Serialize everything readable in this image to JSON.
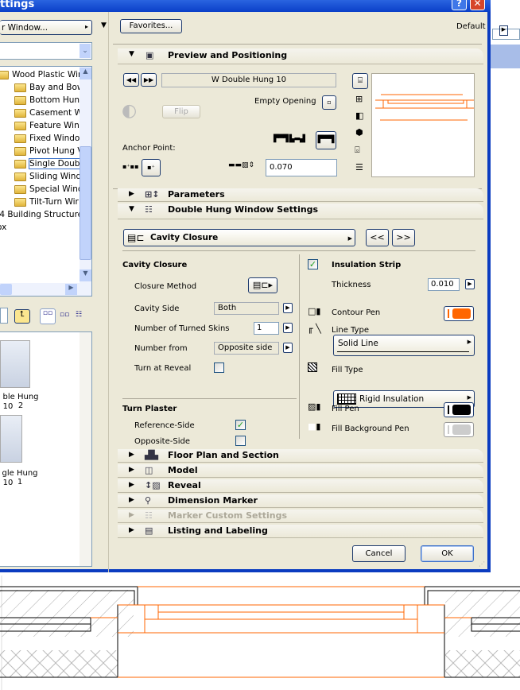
{
  "window": {
    "title": "ttings",
    "help_label": "?",
    "close_label": "✕"
  },
  "left_panel": {
    "dropdown_label": "r Window...",
    "tree": [
      {
        "label": "Wood Plastic Win",
        "level": 0
      },
      {
        "label": "Bay and Bow",
        "level": 1
      },
      {
        "label": "Bottom Hung",
        "level": 1
      },
      {
        "label": "Casement W",
        "level": 1
      },
      {
        "label": "Feature Win",
        "level": 1
      },
      {
        "label": "Fixed Windo",
        "level": 1
      },
      {
        "label": "Pivot Hung V",
        "level": 1
      },
      {
        "label": "Single Double",
        "level": 1,
        "selected": true
      },
      {
        "label": "Sliding Windo",
        "level": 1
      },
      {
        "label": "Special Wind",
        "level": 1
      },
      {
        "label": "Tilt-Turn Wir",
        "level": 1
      },
      {
        "label": ".4 Building Structure",
        "level": -1
      },
      {
        "label": "ox",
        "level": -1
      }
    ],
    "thumbnails": [
      {
        "name": "ble Hung 2",
        "size": "10"
      },
      {
        "name": "gle Hung 1",
        "size": "10"
      }
    ]
  },
  "header": {
    "favorites_label": "Favorites...",
    "default_label": "Default"
  },
  "preview": {
    "title": "Preview and Positioning",
    "object_name": "W Double Hung 10",
    "flip_label": "Flip",
    "empty_opening_label": "Empty Opening",
    "anchor_point_label": "Anchor Point:",
    "offset_value": "0.070"
  },
  "sections": {
    "parameters": "Parameters",
    "double_hung": "Double Hung Window Settings",
    "floor_plan": "Floor Plan and Section",
    "model": "Model",
    "reveal": "Reveal",
    "dimension_marker": "Dimension Marker",
    "marker_custom": "Marker Custom Settings",
    "listing": "Listing and Labeling"
  },
  "settings": {
    "page_select": "Cavity Closure",
    "prev_label": "<<",
    "next_label": ">>",
    "cavity_closure_heading": "Cavity Closure",
    "closure_method_label": "Closure Method",
    "cavity_side_label": "Cavity Side",
    "cavity_side_value": "Both",
    "turned_skins_label": "Number of Turned Skins",
    "turned_skins_value": "1",
    "number_from_label": "Number from",
    "number_from_value": "Opposite side",
    "turn_reveal_label": "Turn at Reveal",
    "turn_reveal_checked": false,
    "turn_plaster_heading": "Turn Plaster",
    "reference_side_label": "Reference-Side",
    "reference_side_checked": true,
    "opposite_side_label": "Opposite-Side",
    "opposite_side_checked": false,
    "insulation_strip_label": "Insulation Strip",
    "insulation_strip_checked": true,
    "thickness_label": "Thickness",
    "thickness_value": "0.010",
    "contour_pen_label": "Contour Pen",
    "contour_pen_color": "#ff6600",
    "line_type_label": "Line Type",
    "line_type_value": "Solid Line",
    "fill_type_label": "Fill Type",
    "fill_type_value": "Rigid Insulation",
    "fill_pen_label": "Fill Pen",
    "fill_pen_color": "#000000",
    "fill_bg_pen_label": "Fill Background Pen",
    "fill_bg_pen_color": "#cccccc"
  },
  "footer": {
    "cancel_label": "Cancel",
    "ok_label": "OK"
  },
  "colors": {
    "accent": "#ff6600",
    "titlebar": "#0a3fc8",
    "dialog_bg": "#ece9d8"
  }
}
